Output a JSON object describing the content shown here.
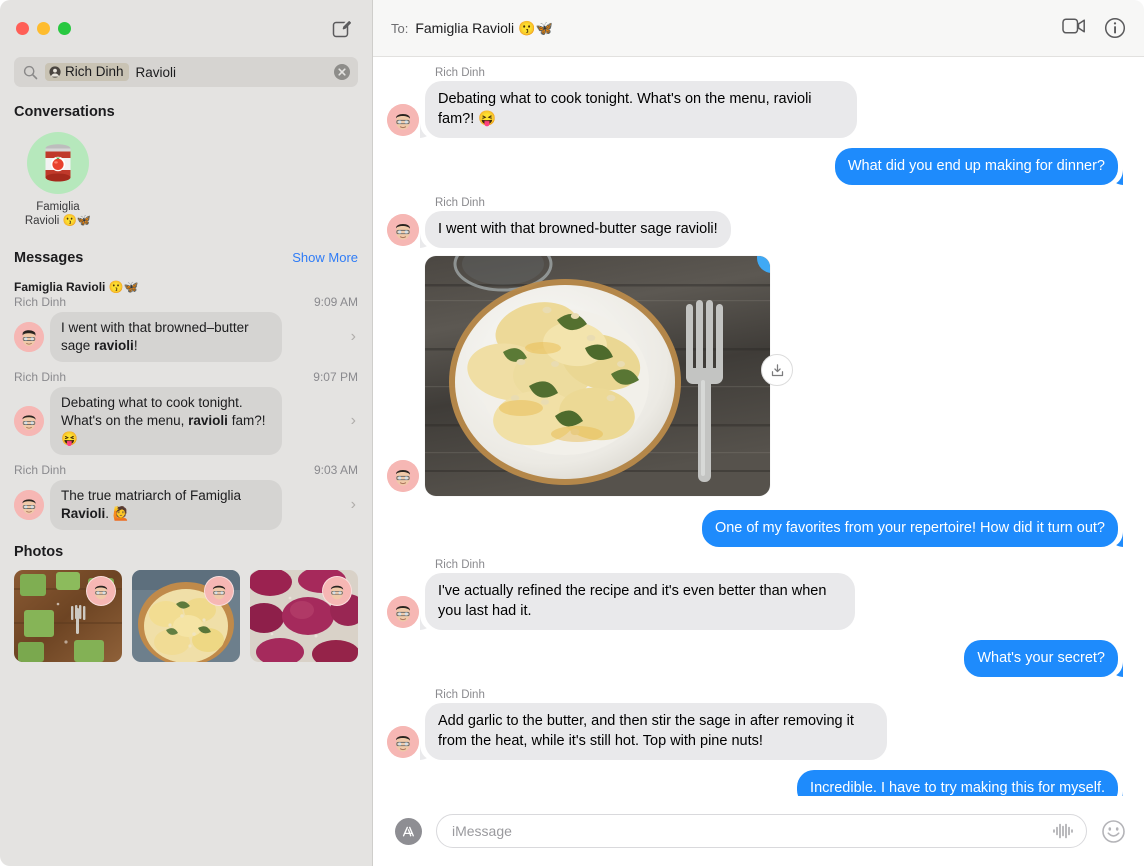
{
  "window": {
    "traffic_lights": [
      "close",
      "minimize",
      "zoom"
    ],
    "compose_icon": "compose-icon"
  },
  "sidebar": {
    "search": {
      "icon": "search-icon",
      "token_icon": "contact-icon",
      "token_label": "Rich Dinh",
      "query_text": "Ravioli",
      "clear_icon": "clear-icon"
    },
    "conversations_header": "Conversations",
    "conversations": [
      {
        "avatar_emoji": "🥫",
        "name_line1": "Famiglia",
        "name_line2": "Ravioli 😗🦋"
      }
    ],
    "messages_header": "Messages",
    "show_more_label": "Show More",
    "message_results": [
      {
        "conversation": "Famiglia Ravioli 😗🦋",
        "sender": "Rich Dinh",
        "time": "9:09 AM",
        "text_prefix": "I went with that browned–butter sage ",
        "text_match": "ravioli",
        "text_suffix": "!",
        "chevron": "chevron-right-icon"
      },
      {
        "conversation": "",
        "sender": "Rich Dinh",
        "time": "9:07 PM",
        "text_prefix": "Debating what to cook tonight. What's on the menu, ",
        "text_match": "ravioli",
        "text_suffix": " fam?! 😝",
        "chevron": "chevron-right-icon"
      },
      {
        "conversation": "",
        "sender": "Rich Dinh",
        "time": "9:03 AM",
        "text_prefix": "The true matriarch of Famiglia ",
        "text_match": "Ravioli",
        "text_suffix": ". 🙋",
        "chevron": "chevron-right-icon"
      }
    ],
    "photos_header": "Photos",
    "photos": [
      {
        "alt": "green spinach ravioli on wooden board"
      },
      {
        "alt": "ravioli with sage in bowl"
      },
      {
        "alt": "beet red ravioli on floured surface"
      }
    ]
  },
  "main": {
    "header": {
      "to_label": "To:",
      "recipient": "Famiglia Ravioli 😗🦋",
      "facetime_icon": "video-camera-icon",
      "info_icon": "info-icon"
    },
    "messages": [
      {
        "direction": "in",
        "sender": "Rich Dinh",
        "text": "Debating what to cook tonight. What's on the menu, ravioli fam?! 😝"
      },
      {
        "direction": "out",
        "text": "What did you end up making for dinner?"
      },
      {
        "direction": "in",
        "sender": "Rich Dinh",
        "text": "I went with that browned-butter sage ravioli!"
      },
      {
        "direction": "in",
        "type": "image",
        "alt": "plate of ravioli with sage butter and pine nuts on rustic wood table with fork",
        "tapback": "loved-heart-icon",
        "download_icon": "download-icon"
      },
      {
        "direction": "out",
        "text": "One of my favorites from your repertoire! How did it turn out?"
      },
      {
        "direction": "in",
        "sender": "Rich Dinh",
        "text": "I've actually refined the recipe and it's even better than when you last had it."
      },
      {
        "direction": "out",
        "text": "What's your secret?"
      },
      {
        "direction": "in",
        "sender": "Rich Dinh",
        "text": "Add garlic to the butter, and then stir the sage in after removing it from the heat, while it's still hot. Top with pine nuts!"
      },
      {
        "direction": "out",
        "text": "Incredible. I have to try making this for myself."
      }
    ],
    "compose": {
      "apps_icon": "app-store-icon",
      "placeholder": "iMessage",
      "value": "",
      "audio_icon": "audio-waveform-icon",
      "emoji_icon": "emoji-smiley-icon"
    }
  },
  "colors": {
    "sidebar_bg": "#e4e3e1",
    "bubble_incoming": "#e9e9eb",
    "bubble_outgoing": "#1e8bfc",
    "accent_link": "#2f7cf6",
    "tapback": "#3fa9f5",
    "tapback_heart": "#fc5f8d"
  }
}
